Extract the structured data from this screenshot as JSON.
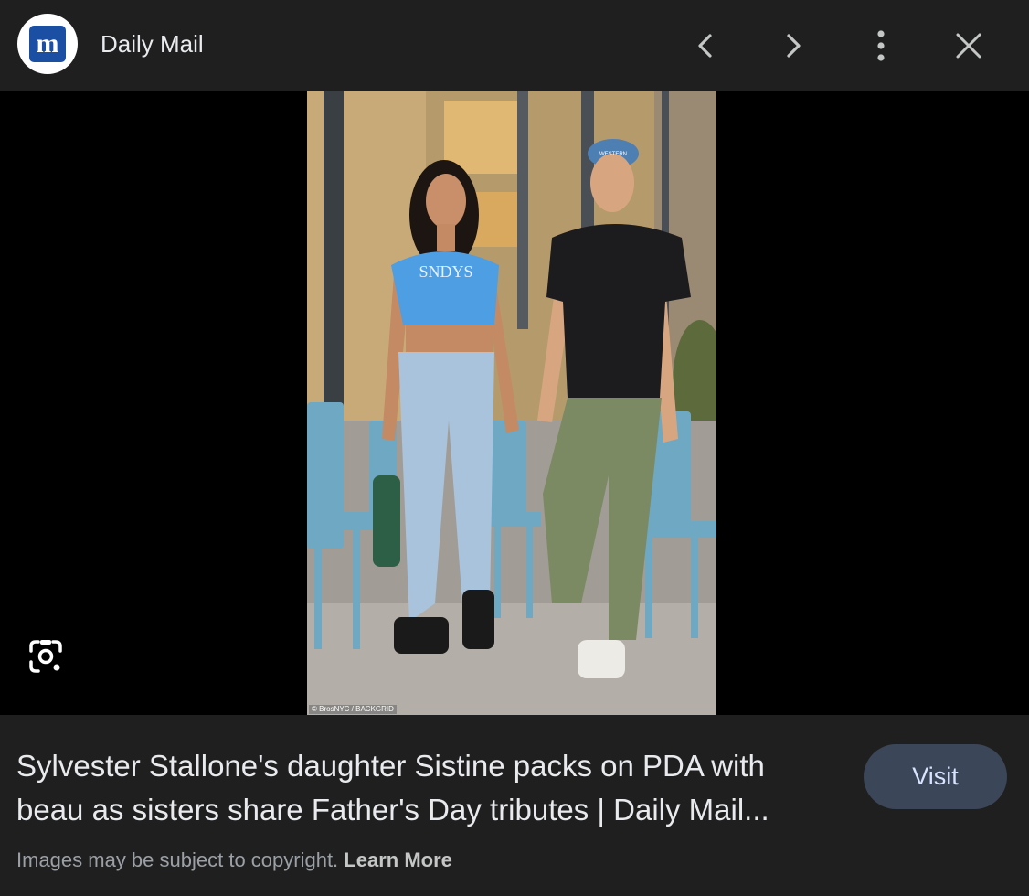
{
  "header": {
    "logo_letter": "m",
    "site_name": "Daily Mail",
    "prev_icon": "chevron-left-icon",
    "next_icon": "chevron-right-icon",
    "more_icon": "more-vert-icon",
    "close_icon": "close-icon"
  },
  "image": {
    "shirt_text": "SNDYS",
    "cap_text": "WESTERN",
    "credit": "© BrosNYC / BACKGRID",
    "lens_icon": "google-lens-icon"
  },
  "result": {
    "title": "Sylvester Stallone's daughter Sistine packs on PDA with beau as sisters share Father's Day tributes | Daily Mail...",
    "visit_label": "Visit",
    "copyright_text": "Images may be subject to copyright.",
    "learn_more_label": "Learn More"
  },
  "colors": {
    "background": "#1f1f1f",
    "viewer_background": "#000000",
    "visit_button": "#3c4659",
    "brand_blue": "#1b4fa3"
  }
}
